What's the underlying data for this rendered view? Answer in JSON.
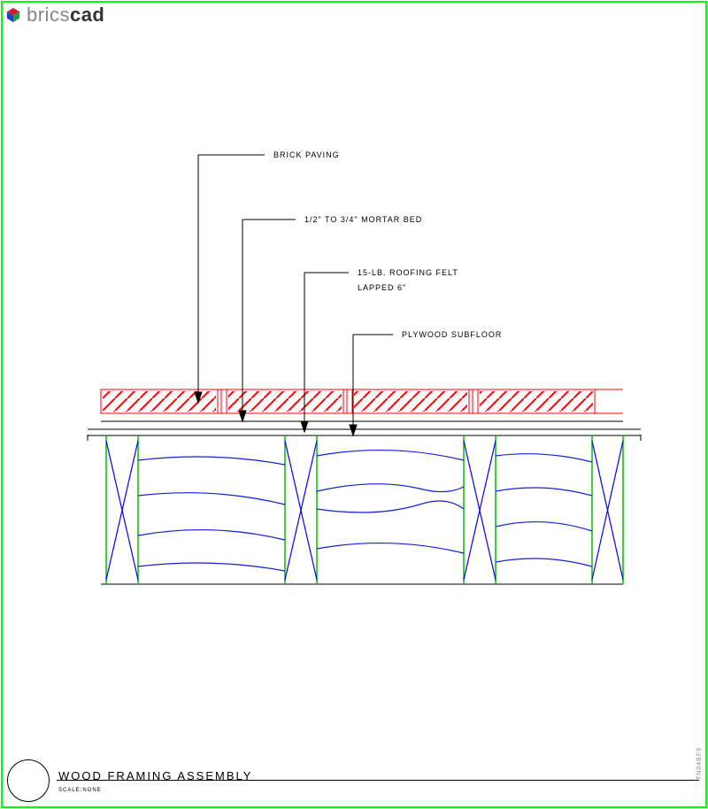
{
  "header": {
    "brand_prefix": "brics",
    "brand_suffix": "cad"
  },
  "labels": {
    "brick_paving": "BRICK PAVING",
    "mortar_bed": "1/2\" TO 3/4\" MORTAR BED",
    "roofing_felt_1": "15-LB. ROOFING FELT",
    "roofing_felt_2": "LAPPED 6\"",
    "plywood": "PLYWOOD SUBFLOOR"
  },
  "title_block": {
    "title": "WOOD FRAMING ASSEMBLY",
    "scale": "SCALE:NONE"
  },
  "side_ref": "TN04BF9"
}
